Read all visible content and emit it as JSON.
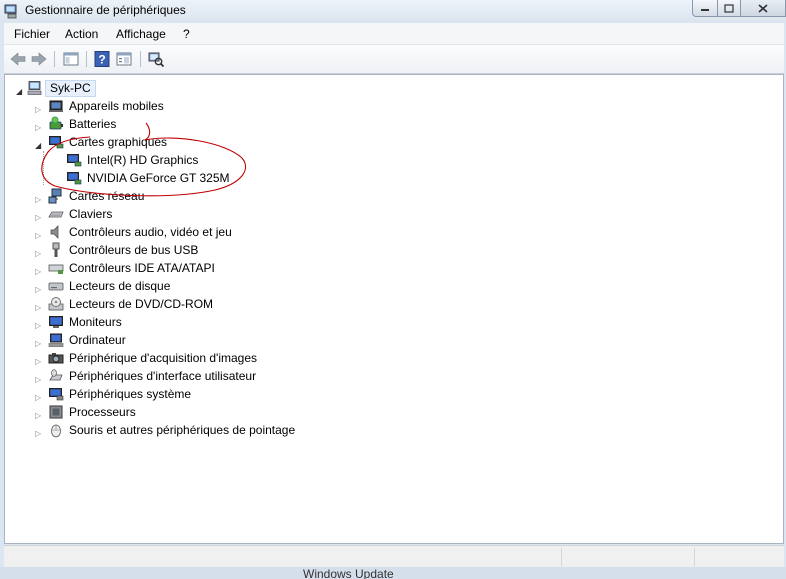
{
  "window": {
    "title": "Gestionnaire de périphériques"
  },
  "menu": {
    "items": [
      "Fichier",
      "Action",
      "Affichage",
      "?"
    ]
  },
  "tree": {
    "root": "Syk-PC",
    "categories": [
      {
        "label": "Appareils mobiles",
        "icon": "mobile-device-icon"
      },
      {
        "label": "Batteries",
        "icon": "battery-icon"
      },
      {
        "label": "Cartes graphiques",
        "icon": "display-adapter-icon",
        "expanded": true,
        "children": [
          "Intel(R) HD Graphics",
          "NVIDIA GeForce GT 325M"
        ]
      },
      {
        "label": "Cartes réseau",
        "icon": "network-adapter-icon"
      },
      {
        "label": "Claviers",
        "icon": "keyboard-icon"
      },
      {
        "label": "Contrôleurs audio, vidéo et jeu",
        "icon": "speaker-icon"
      },
      {
        "label": "Contrôleurs de bus USB",
        "icon": "usb-icon"
      },
      {
        "label": "Contrôleurs IDE ATA/ATAPI",
        "icon": "ide-controller-icon"
      },
      {
        "label": "Lecteurs de disque",
        "icon": "disk-drive-icon"
      },
      {
        "label": "Lecteurs de DVD/CD-ROM",
        "icon": "dvd-drive-icon"
      },
      {
        "label": "Moniteurs",
        "icon": "monitor-icon"
      },
      {
        "label": "Ordinateur",
        "icon": "computer-icon"
      },
      {
        "label": "Périphérique d'acquisition d'images",
        "icon": "camera-icon"
      },
      {
        "label": "Périphériques d'interface utilisateur",
        "icon": "hid-icon"
      },
      {
        "label": "Périphériques système",
        "icon": "system-device-icon"
      },
      {
        "label": "Processeurs",
        "icon": "processor-icon"
      },
      {
        "label": "Souris et autres périphériques de pointage",
        "icon": "mouse-icon"
      }
    ]
  },
  "background_window": {
    "text": "Windows Update"
  },
  "colors": {
    "annotation": "#c00000",
    "selection": "#3399ff"
  }
}
